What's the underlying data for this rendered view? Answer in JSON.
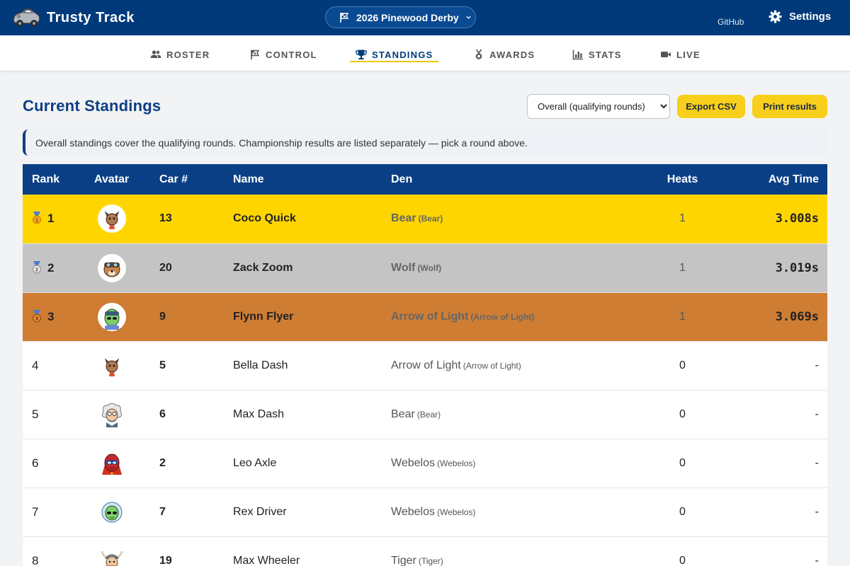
{
  "header": {
    "app_name": "Trusty Track",
    "event_name": "2026 Pinewood Derby",
    "github_label": "GitHub",
    "settings_label": "Settings"
  },
  "nav": {
    "tabs": [
      {
        "label": "ROSTER",
        "icon": "people-icon"
      },
      {
        "label": "CONTROL",
        "icon": "flag-icon"
      },
      {
        "label": "STANDINGS",
        "icon": "trophy-icon",
        "active": true
      },
      {
        "label": "AWARDS",
        "icon": "medal-icon"
      },
      {
        "label": "STATS",
        "icon": "bar-chart-icon"
      },
      {
        "label": "LIVE",
        "icon": "video-camera-icon"
      }
    ]
  },
  "main": {
    "title": "Current Standings",
    "round_select": {
      "selected": "Overall (qualifying rounds)"
    },
    "export_label": "Export CSV",
    "print_label": "Print results",
    "info_note": "Overall standings cover the qualifying rounds. Championship results are listed separately — pick a round above."
  },
  "table": {
    "headers": {
      "rank": "Rank",
      "avatar": "Avatar",
      "car": "Car #",
      "name": "Name",
      "den": "Den",
      "heats": "Heats",
      "avg": "Avg Time"
    },
    "rows": [
      {
        "rank": "1",
        "car": "13",
        "name": "Coco Quick",
        "den": "Bear",
        "den_sub": "(Bear)",
        "heats": "1",
        "avg": "3.008s",
        "avatar": "cat-avatar"
      },
      {
        "rank": "2",
        "car": "20",
        "name": "Zack Zoom",
        "den": "Wolf",
        "den_sub": "(Wolf)",
        "heats": "1",
        "avg": "3.019s",
        "avatar": "dog-pilot-avatar"
      },
      {
        "rank": "3",
        "car": "9",
        "name": "Flynn Flyer",
        "den": "Arrow of Light",
        "den_sub": "(Arrow of Light)",
        "heats": "1",
        "avg": "3.069s",
        "avatar": "alien-avatar"
      },
      {
        "rank": "4",
        "car": "5",
        "name": "Bella Dash",
        "den": "Arrow of Light",
        "den_sub": "(Arrow of Light)",
        "heats": "0",
        "avg": "-",
        "avatar": "cat-avatar"
      },
      {
        "rank": "5",
        "car": "6",
        "name": "Max Dash",
        "den": "Bear",
        "den_sub": "(Bear)",
        "heats": "0",
        "avg": "-",
        "avatar": "scientist-avatar"
      },
      {
        "rank": "6",
        "car": "2",
        "name": "Leo Axle",
        "den": "Webelos",
        "den_sub": "(Webelos)",
        "heats": "0",
        "avg": "-",
        "avatar": "superhero-avatar"
      },
      {
        "rank": "7",
        "car": "7",
        "name": "Rex Driver",
        "den": "Webelos",
        "den_sub": "(Webelos)",
        "heats": "0",
        "avg": "-",
        "avatar": "alien-avatar"
      },
      {
        "rank": "8",
        "car": "19",
        "name": "Max Wheeler",
        "den": "Tiger",
        "den_sub": "(Tiger)",
        "heats": "0",
        "avg": "-",
        "avatar": "viking-avatar"
      }
    ]
  },
  "colors": {
    "primary": "#0b3f85",
    "accent": "#f8cf1a",
    "gold": "#ffd500",
    "silver": "#c4c4c4",
    "bronze": "#ce7d33"
  }
}
